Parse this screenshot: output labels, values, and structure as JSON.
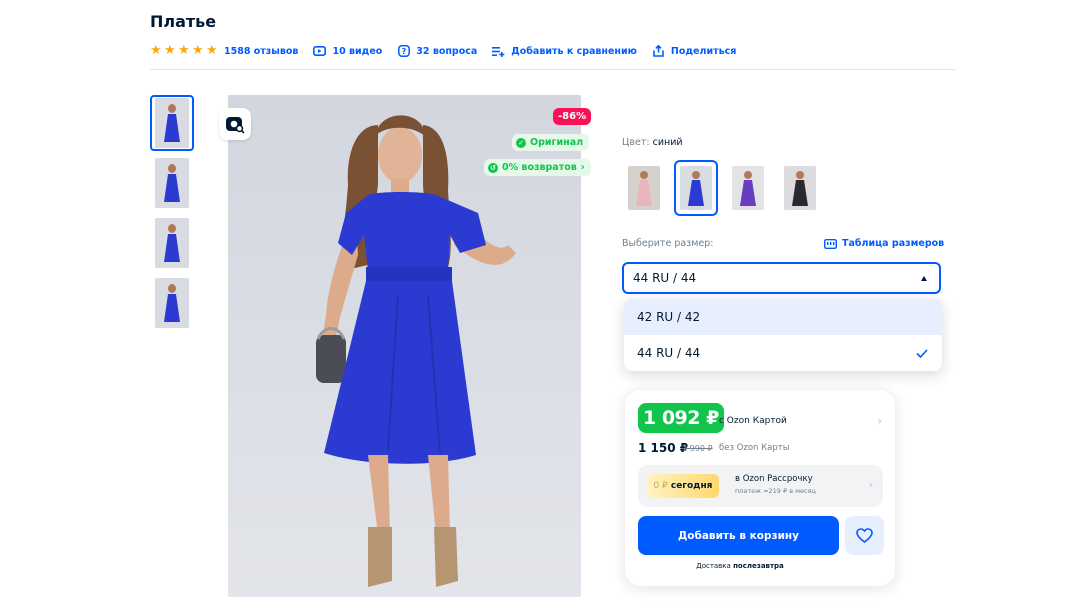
{
  "product": {
    "title": "Платье"
  },
  "meta": {
    "rating_stars": 5,
    "reviews": "1588 отзывов",
    "videos": "10 видео",
    "questions": "32 вопроса",
    "compare": "Добавить к сравнению",
    "share": "Поделиться"
  },
  "gallery": {
    "thumb_count": 4,
    "active_index": 0
  },
  "badges": {
    "discount": "-86%",
    "original": "Оригинал",
    "returns": "0% возвратов"
  },
  "color": {
    "label": "Цвет:",
    "value": "синий",
    "swatches": [
      {
        "name": "pink",
        "color": "#e8b4bd"
      },
      {
        "name": "blue",
        "color": "#2b3bd1"
      },
      {
        "name": "floral-purple",
        "color": "#6a3cc0"
      },
      {
        "name": "black",
        "color": "#2a2a2e"
      }
    ],
    "active_index": 1
  },
  "size": {
    "label": "Выберите размер:",
    "table_link": "Таблица размеров",
    "selected": "44 RU / 44",
    "options": [
      "42 RU / 42",
      "44 RU / 44"
    ]
  },
  "price": {
    "card_price": "1 092 ₽",
    "card_price_note": "с Ozon Картой",
    "regular_price": "1 150 ₽",
    "old_price": "7 990 ₽",
    "regular_note": "без Ozon Карты"
  },
  "installment": {
    "badge_zero": "0 ₽",
    "badge_today": "сегодня",
    "title": "в Ozon Рассрочку",
    "subtitle": "платеж ≈219 ₽ в месяц"
  },
  "cart": {
    "add_label": "Добавить в корзину",
    "delivery_prefix": "Доставка",
    "delivery_value": "послезавтра"
  },
  "colors": {
    "accent": "#005bff",
    "green": "#10c44c",
    "discount": "#f91155",
    "star": "#ffa800"
  }
}
